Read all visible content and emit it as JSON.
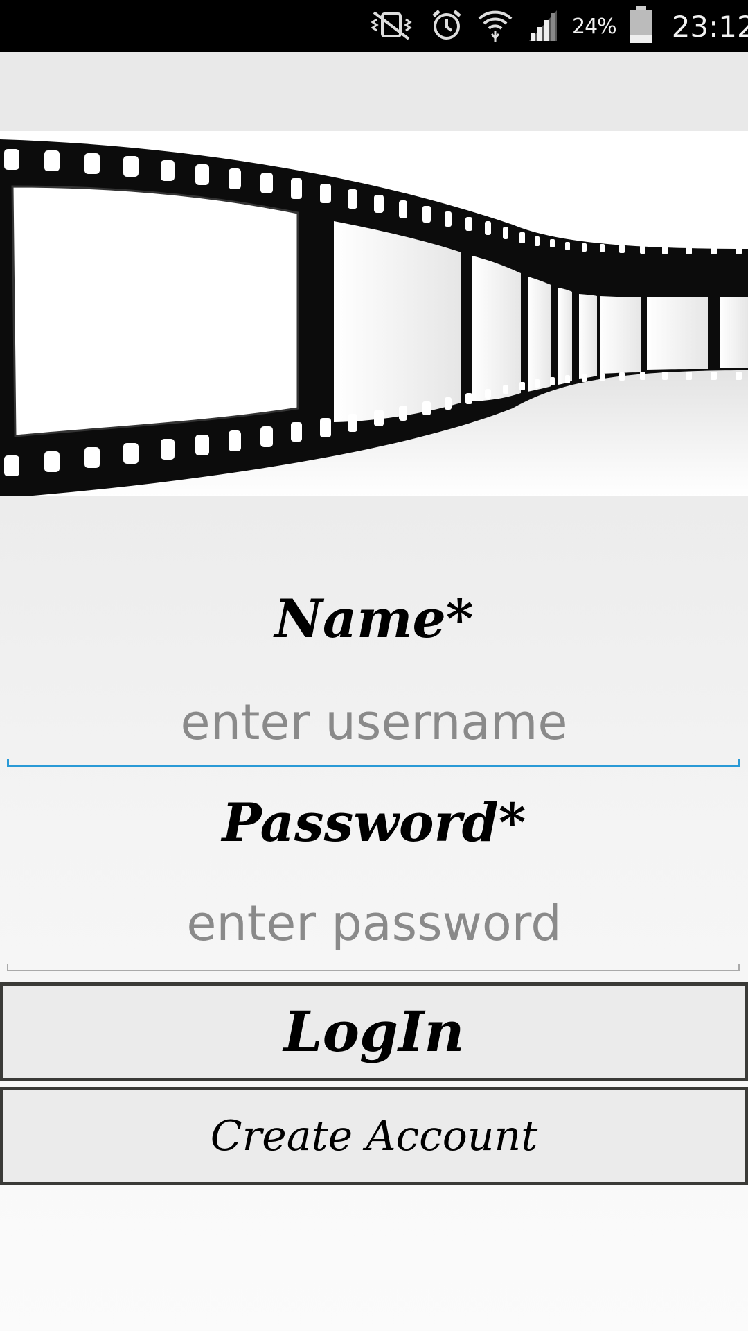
{
  "status_bar": {
    "battery_percent": "24%",
    "time": "23:12",
    "icons": [
      "mute-vibrate-icon",
      "alarm-icon",
      "wifi-icon",
      "signal-icon",
      "battery-icon"
    ]
  },
  "hero": {
    "image": "film-strip-image"
  },
  "form": {
    "name_label": "Name*",
    "username_placeholder": "enter username",
    "password_label": "Password*",
    "password_placeholder": "enter password"
  },
  "buttons": {
    "login_label": "LogIn",
    "create_account_label": "Create Account"
  },
  "colors": {
    "status_bar": "#000000",
    "accent_underline": "#2a9ad6",
    "button_border": "#3a3a37",
    "button_fill": "#ebebeb"
  }
}
